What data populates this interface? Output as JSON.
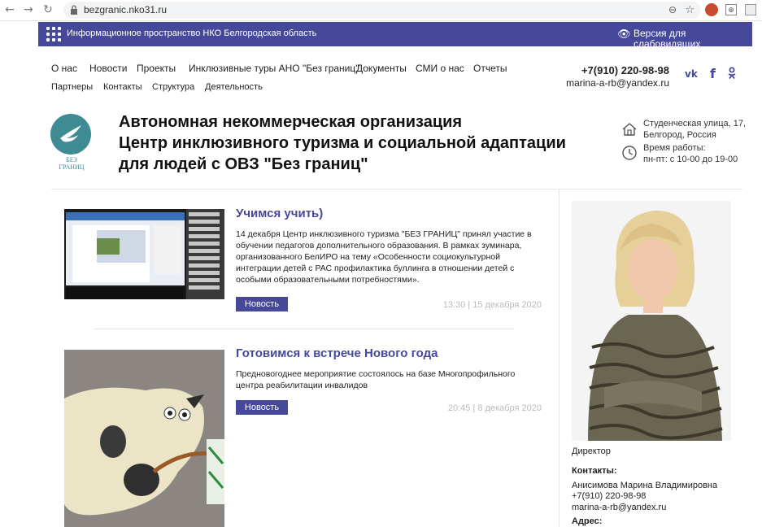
{
  "browser": {
    "url": "bezgranic.nko31.ru",
    "back_glyph": "←",
    "forward_glyph": "→",
    "reload_glyph": "↻"
  },
  "topbar": {
    "info_text": "Информационное пространство НКО Белгородская область",
    "vision_version": "Версия для слабовидящих",
    "color": "#46489a"
  },
  "nav": {
    "row1": [
      "О нас",
      "Новости",
      "Проекты",
      "Инклюзивные туры АНО \"Без границ\"",
      "Документы",
      "СМИ о нас",
      "Отчеты"
    ],
    "row2": [
      "Партнеры",
      "Контакты",
      "Структура",
      "Деятельность"
    ]
  },
  "contacts_header": {
    "phone": "+7(910) 220-98-98",
    "email": "marina-a-rb@yandex.ru",
    "social": [
      "vk-icon",
      "facebook-icon",
      "odnoklassniki-icon"
    ]
  },
  "header": {
    "logo_text": "БЕЗ ГРАНИЦ",
    "title_lines": [
      "Автономная некоммерческая организация",
      "Центр инклюзивного туризма и социальной адаптации",
      "для людей с ОВЗ \"Без границ\""
    ],
    "address_line1": "Студенческая улица, 17,",
    "address_line2": "Белгород, Россия",
    "hours_label": "Время работы:",
    "hours_value": "пн-пт: с 10-00 до 19-00"
  },
  "news": [
    {
      "title": "Учимся учить)",
      "text": "14 декабря Центр инклюзивного туризма \"БЕЗ ГРАНИЦ\" принял участие в обучении педагогов дополнительного образования. В рамках зуминара, организованного БелИРО на тему «Особенности социокультурной интеграции детей с РАС профилактика буллинга в отношении детей с особыми образовательными потребностями».",
      "tag": "Новость",
      "date": "13:30 | 15 декабря 2020"
    },
    {
      "title": "Готовимся к встрече Нового года",
      "text": "Предновогоднее мероприятие состоялось на базе Многопрофильного центра реабилитации инвалидов",
      "tag": "Новость",
      "date": "20:45 | 8 декабря 2020"
    }
  ],
  "sidebar": {
    "role": "Директор",
    "contacts_label": "Контакты:",
    "name": "Анисимова Марина Владимировна",
    "phone": "+7(910) 220-98-98",
    "email": "marina-a-rb@yandex.ru",
    "address_label": "Адрес:"
  }
}
